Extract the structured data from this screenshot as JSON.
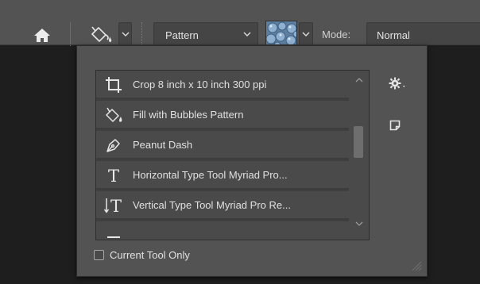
{
  "options_bar": {
    "pattern_label": "Pattern",
    "mode_label": "Mode:",
    "mode_value": "Normal"
  },
  "presets": {
    "items": [
      {
        "label": "Crop 8 inch x 10 inch 300 ppi",
        "icon": "crop-icon"
      },
      {
        "label": "Fill with Bubbles Pattern",
        "icon": "paint-bucket-icon"
      },
      {
        "label": "Peanut Dash",
        "icon": "pen-tool-icon"
      },
      {
        "label": "Horizontal Type Tool Myriad Pro...",
        "icon": "horizontal-type-icon"
      },
      {
        "label": "Vertical Type Tool Myriad Pro Re...",
        "icon": "vertical-type-icon"
      }
    ],
    "current_tool_only_label": "Current Tool Only"
  },
  "colors": {
    "bar_bg": "#535353",
    "field_bg": "#454545",
    "canvas_bg": "#1e1e1e"
  }
}
